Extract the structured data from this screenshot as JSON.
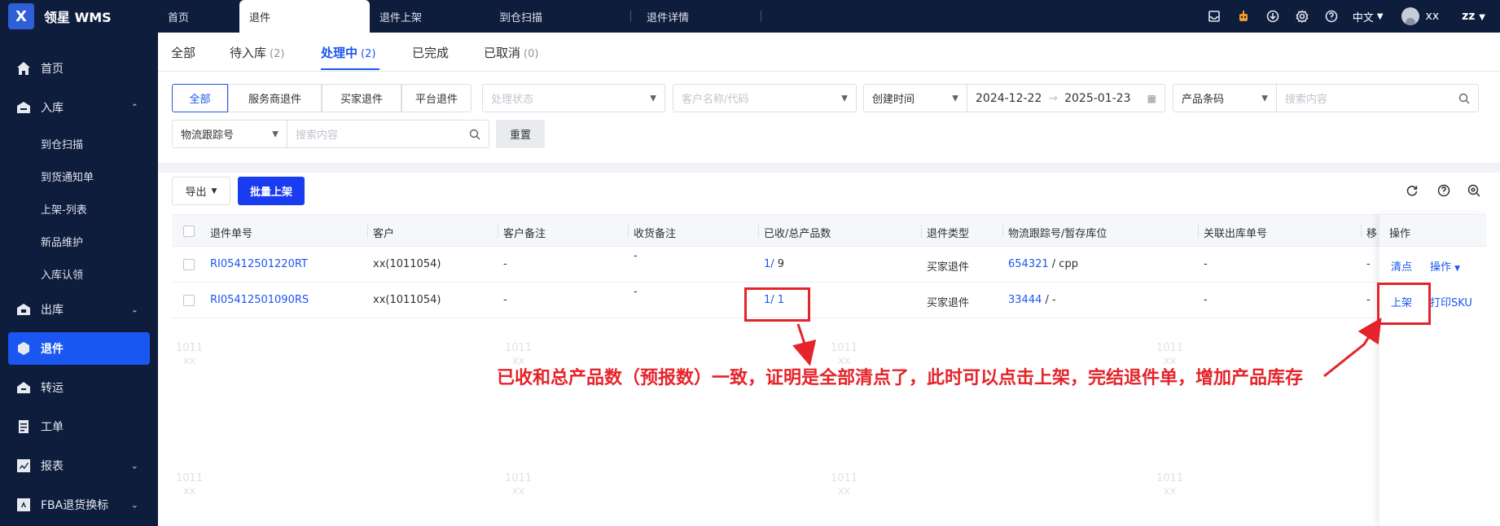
{
  "app": {
    "logo_text": "领星 WMS",
    "logo_mark": "X"
  },
  "sidebar": {
    "items": [
      {
        "label": "首页",
        "icon": "home-icon"
      },
      {
        "label": "入库",
        "icon": "inbound-icon",
        "chev": "⌃"
      },
      {
        "label": "出库",
        "icon": "outbound-icon",
        "chev": "⌄"
      },
      {
        "label": "退件",
        "icon": "return-icon"
      },
      {
        "label": "转运",
        "icon": "transfer-icon"
      },
      {
        "label": "工单",
        "icon": "workorder-icon"
      },
      {
        "label": "报表",
        "icon": "report-icon",
        "chev": "⌄"
      },
      {
        "label": "FBA退货换标",
        "icon": "fba-icon",
        "chev": "⌄"
      }
    ],
    "subitems": [
      "到仓扫描",
      "到货通知单",
      "上架-列表",
      "新品维护",
      "入库认领"
    ]
  },
  "topbar": {
    "tabs": [
      "首页",
      "退件",
      "退件上架",
      "到仓扫描",
      "退件详情"
    ],
    "active_tab": "退件",
    "lang": "中文",
    "user": "xx",
    "tenant": "zz"
  },
  "status_tabs": [
    {
      "label": "全部",
      "count": ""
    },
    {
      "label": "待入库",
      "count": "(2)"
    },
    {
      "label": "处理中",
      "count": "(2)"
    },
    {
      "label": "已完成",
      "count": ""
    },
    {
      "label": "已取消",
      "count": "(0)"
    }
  ],
  "filters": {
    "segments": [
      "全部",
      "服务商退件",
      "买家退件",
      "平台退件"
    ],
    "status_placeholder": "处理状态",
    "customer_placeholder": "客户名称/代码",
    "date_type": "创建时间",
    "date_start": "2024-12-22",
    "date_arrow": "→",
    "date_end": "2025-01-23",
    "product_field": "产品条码",
    "search_placeholder": "搜索内容",
    "tracking_field": "物流跟踪号",
    "search_placeholder_2": "搜索内容",
    "reset": "重置"
  },
  "actions": {
    "export": "导出",
    "batch_putaway": "批量上架"
  },
  "table": {
    "headers": [
      "退件单号",
      "客户",
      "客户备注",
      "收货备注",
      "已收/总产品数",
      "退件类型",
      "物流跟踪号/暂存库位",
      "关联出库单号",
      "移",
      "操作"
    ],
    "rows": [
      {
        "order": "RI05412501220RT",
        "customer": "xx(1011054)",
        "cust_note": "-",
        "recv_note": "-",
        "received": "1/",
        "total": "9",
        "type": "买家退件",
        "tracking": "654321",
        "location": "/ cpp",
        "outbound": "-",
        "move": "-",
        "op1": "清点",
        "op2": "操作"
      },
      {
        "order": "RI05412501090RS",
        "customer": "xx(1011054)",
        "cust_note": "-",
        "recv_note": "-",
        "received": "1/",
        "total": "1",
        "type": "买家退件",
        "tracking": "33444",
        "location": "/ -",
        "outbound": "-",
        "move": "-",
        "op1": "上架",
        "op2": "打印SKU"
      }
    ]
  },
  "watermark": {
    "line1": "1011",
    "line2": "xx"
  },
  "annotation": "已收和总产品数（预报数）一致，证明是全部清点了，此时可以点击上架，完结退件单，增加产品库存",
  "colors": {
    "sidebar_bg": "#0f1d3d",
    "accent": "#1a56f0",
    "annotation_red": "#e5232a"
  }
}
